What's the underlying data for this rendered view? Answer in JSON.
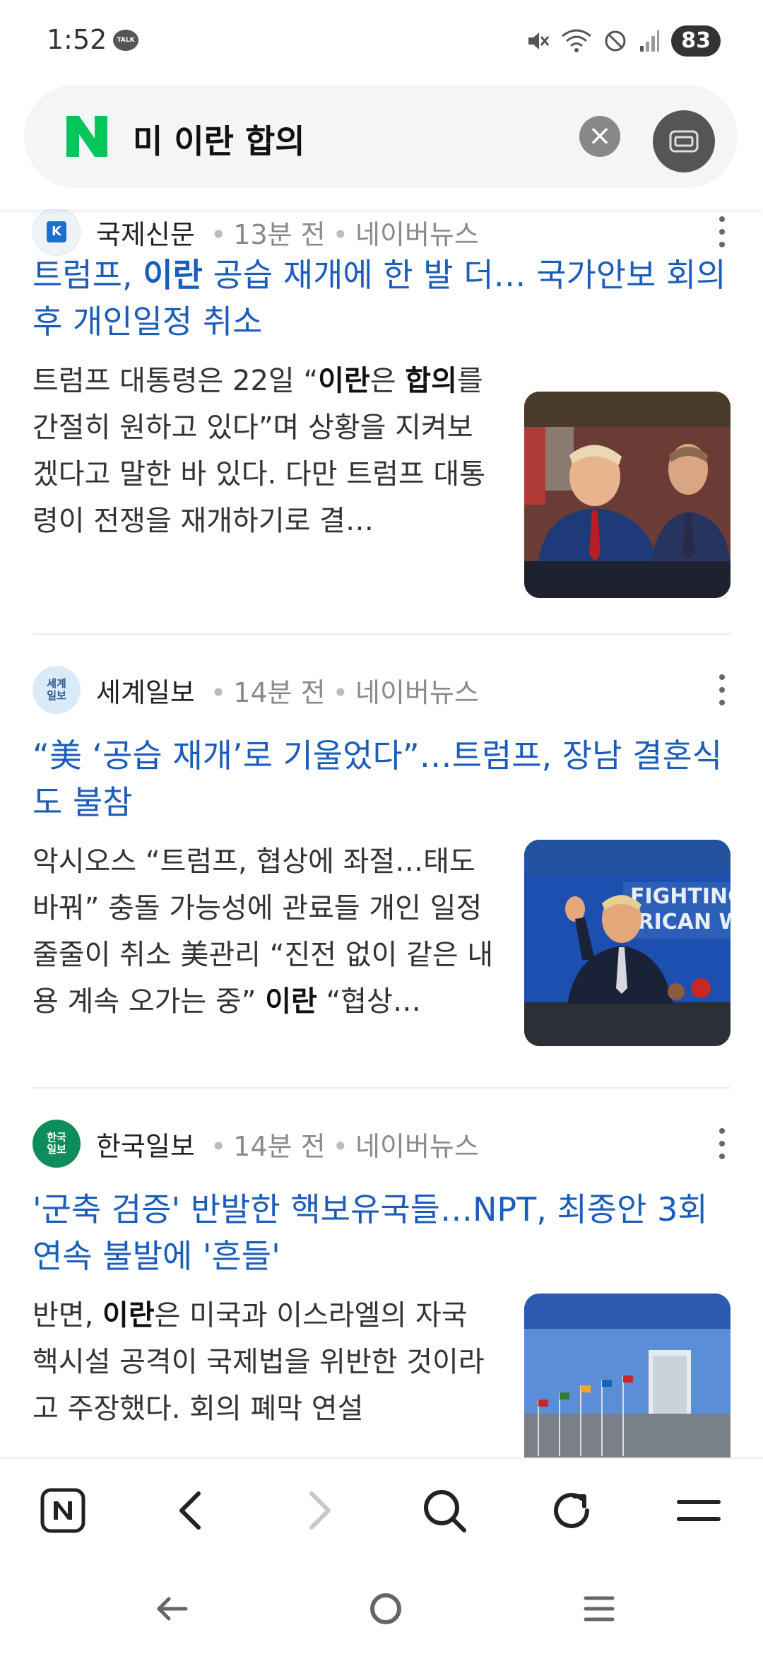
{
  "status_bar": {
    "time": "1:52",
    "talk_label": "TALK",
    "battery": "83"
  },
  "search": {
    "query": "미 이란 합의"
  },
  "articles": [
    {
      "source": "국제신문",
      "logo_text": "K",
      "time": "13분 전",
      "platform": "네이버뉴스",
      "headline_parts": [
        "트럼프, ",
        "이란",
        " 공습 재개에 한 발 더… 국가안보 회의 후 개인일정 취소"
      ],
      "snippet_parts": [
        "트럼프 대통령은 22일 “",
        "이란",
        "은 ",
        "합의",
        "를 간절히 원하고 있다”며 상황을 지켜보겠다고 말한 바 있다. 다만 트럼프 대통령이 전쟁을 재개하기로 결…"
      ]
    },
    {
      "source": "세계일보",
      "logo_text": "세계일보",
      "time": "14분 전",
      "platform": "네이버뉴스",
      "headline_parts": [
        "“美 ‘공습 재개’로 기울었다”…트럼프, 장남 결혼식 도 불참"
      ],
      "snippet_parts": [
        "악시오스 “트럼프, 협상에 좌절…태도 바꿔” 충돌 가능성에 관료들 개인 일정 줄줄이 취소 美관리 “진전 없이 같은 내용 계속 오가는 중” ",
        "이란",
        " “협상…"
      ]
    },
    {
      "source": "한국일보",
      "logo_text": "한국일보",
      "time": "14분 전",
      "platform": "네이버뉴스",
      "headline_parts": [
        "'군축 검증' 반발한 핵보유국들…NPT, 최종안 3회 연속 불발에 '흔들'"
      ],
      "snippet_parts": [
        "반면, ",
        "이란",
        "은 미국과 이스라엘의 자국 핵시설 공격이 국제법을 위반한 것이라고 주장했다. 회의 폐막 연설"
      ]
    }
  ],
  "colors": {
    "naver_green": "#03c75a",
    "headline_blue": "#1a5dbb",
    "search_bg": "#f4f5f7"
  },
  "icons": {
    "bottom_nav": [
      "naver-home-icon",
      "back-icon",
      "forward-icon",
      "search-icon",
      "refresh-icon",
      "menu-icon"
    ],
    "system_nav": [
      "system-back-icon",
      "system-home-icon",
      "system-recents-icon"
    ]
  }
}
